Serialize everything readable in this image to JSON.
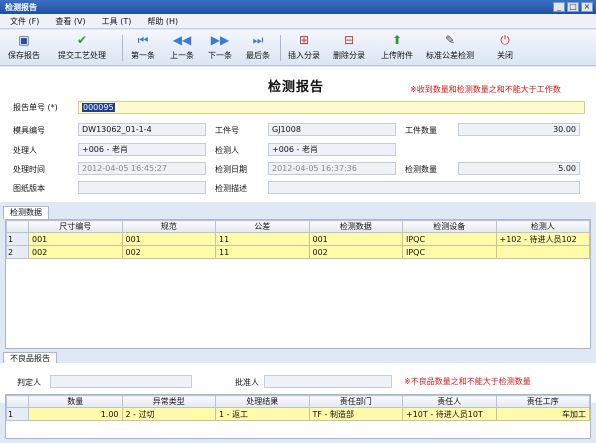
{
  "window": {
    "title": "检测报告",
    "min": "_",
    "max": "□",
    "close": "×"
  },
  "menu": [
    "文件 (F)",
    "查看 (V)",
    "工具 (T)",
    "帮助 (H)"
  ],
  "toolbar": {
    "save": "保存报告",
    "submit": "提交工艺处理",
    "first": "第一条",
    "prev": "上一条",
    "next": "下一条",
    "last": "最后条",
    "insert_split": "插入分录",
    "delete_split": "删除分录",
    "upload": "上传附件",
    "std_check": "标准公差检测",
    "close": "关闭"
  },
  "form": {
    "heading": "检测报告",
    "warning": "※收到数量和检测数量之和不能大于工作数",
    "report_no_label": "报告单号 (*)",
    "report_no": "000095",
    "mold_no_label": "模具编号",
    "mold_no": "DW13062_01-1-4",
    "job_no_label": "工件号",
    "job_no": "GJ1008",
    "job_qty_label": "工件数量",
    "job_qty": "30.00",
    "handler_label": "处理人",
    "handler": "+006 - 老肖",
    "inspector_label": "检测人",
    "inspector": "+006 - 老肖",
    "handle_time_label": "处理时间",
    "handle_time": "2012-04-05 16:45:27",
    "check_date_label": "检测日期",
    "check_date": "2012-04-05 16:37:36",
    "check_qty_label": "检测数量",
    "check_qty": "5.00",
    "drawing_ver_label": "图纸版本",
    "drawing_ver": "",
    "check_desc_label": "检测描述",
    "check_desc": ""
  },
  "inspect_grid": {
    "tab": "检测数据",
    "headers": [
      "尺寸编号",
      "规范",
      "公差",
      "检测数据",
      "检测设备",
      "检测人"
    ],
    "rows": [
      {
        "n": "1",
        "cells": [
          "001",
          "001",
          "11",
          "001",
          "IPQC",
          "+102 - 待进人员102"
        ]
      },
      {
        "n": "2",
        "cells": [
          "002",
          "002",
          "11",
          "002",
          "IPQC",
          ""
        ]
      }
    ]
  },
  "defect": {
    "tab": "不良品报告",
    "judge_label": "判定人",
    "judge": "",
    "approver_label": "批准人",
    "approver": "",
    "warning": "※不良品数量之和不能大于检测数量",
    "headers": [
      "数量",
      "异常类型",
      "处理结果",
      "责任部门",
      "责任人",
      "责任工序"
    ],
    "rows": [
      {
        "n": "1",
        "cells": [
          "1.00",
          "2 - 过切",
          "1 - 返工",
          "TF - 制造部",
          "+10T - 待进人员10T",
          "车加工"
        ]
      }
    ]
  },
  "colors": {
    "accent": "#1f4f9e",
    "highlight_row": "#fffba8",
    "warning": "#d21b1b"
  }
}
